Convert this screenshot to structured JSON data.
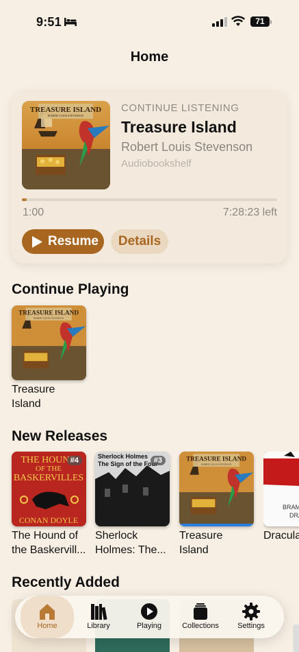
{
  "status_bar": {
    "time": "9:51",
    "battery": "71"
  },
  "page_title": "Home",
  "hero": {
    "eyebrow": "CONTINUE LISTENING",
    "title": "Treasure Island",
    "author": "Robert Louis Stevenson",
    "source": "Audiobookshelf",
    "progress_fraction": 0.02,
    "elapsed": "1:00",
    "remaining": "7:28:23 left",
    "resume_label": "Resume",
    "details_label": "Details",
    "cover_title": "TREASURE ISLAND",
    "cover_subtitle": "ROBERT LOUIS STEVENSON"
  },
  "continue_playing": {
    "title": "Continue Playing",
    "items": [
      {
        "label": "Treasure Island",
        "cover_title": "TREASURE ISLAND",
        "cover_subtitle": "ROBERT LOUIS STEVENSON"
      }
    ]
  },
  "new_releases": {
    "title": "New Releases",
    "items": [
      {
        "label": "The Hound of the Baskervill...",
        "badge": "#4",
        "cover_line1": "THE HOUND",
        "cover_line2": "OF THE",
        "cover_line3": "BASKERVILLES",
        "cover_author": "CONAN DOYLE"
      },
      {
        "label": "Sherlock Holmes: The...",
        "badge": "#3",
        "cover_line1": "Sherlock Holmes",
        "cover_line2": "The Sign of the Four"
      },
      {
        "label": "Treasure Island",
        "cover_title": "TREASURE ISLAND",
        "cover_subtitle": "ROBERT LOUIS STEVENSON"
      },
      {
        "label": "Dracula",
        "cover_line1": "BRAM",
        "cover_line2": "DRA"
      }
    ]
  },
  "recently_added": {
    "title": "Recently Added"
  },
  "tabs": [
    {
      "label": "Home",
      "icon": "house-icon",
      "active": true
    },
    {
      "label": "Library",
      "icon": "books-icon",
      "active": false
    },
    {
      "label": "Playing",
      "icon": "play-circle-icon",
      "active": false
    },
    {
      "label": "Collections",
      "icon": "collections-icon",
      "active": false
    },
    {
      "label": "Settings",
      "icon": "gear-icon",
      "active": false
    }
  ],
  "colors": {
    "accent": "#a86620",
    "background": "#f7efe4",
    "progress": "#b87a35"
  }
}
